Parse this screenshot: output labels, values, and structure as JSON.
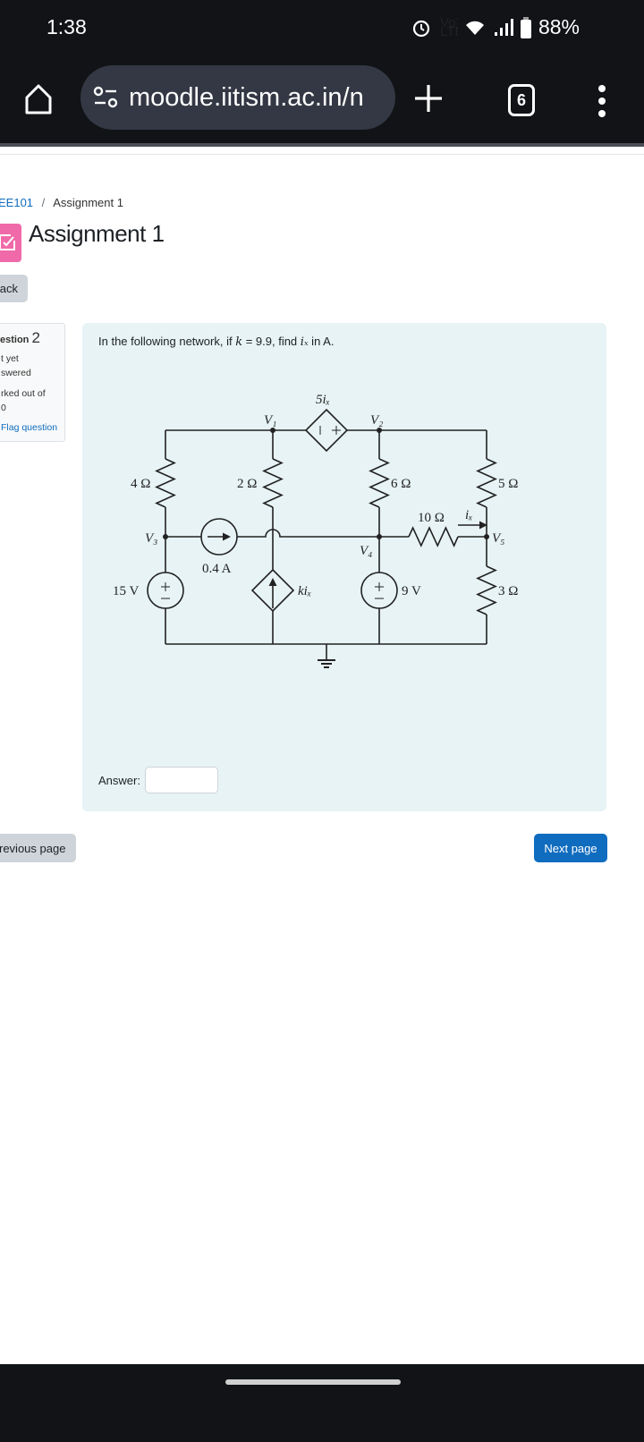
{
  "status_bar": {
    "time": "1:38",
    "battery": "88%",
    "icons": [
      "alarm-icon",
      "volte-icon",
      "wifi-icon",
      "signal-icon",
      "battery-icon"
    ]
  },
  "browser": {
    "url": "moodle.iitism.ac.in/n",
    "tab_count": "6",
    "icons": [
      "home-icon",
      "site-settings-icon",
      "new-tab-plus-icon",
      "tabs-icon",
      "more-menu-icon"
    ]
  },
  "breadcrumb": {
    "course": "EE101",
    "separator": "/",
    "current": "Assignment 1"
  },
  "page": {
    "title": "Assignment 1",
    "back_label": "ack",
    "accent": "#f06aa9"
  },
  "question_info": {
    "label": "estion",
    "number": "2",
    "status_line1": "t yet",
    "status_line2": "swered",
    "marks_line1": "rked out of",
    "marks_line2": "0",
    "flag_label": "Flag question"
  },
  "question": {
    "text_pre": "In the following network, if ",
    "k_symbol": "k",
    "text_mid": " = 9.9, find ",
    "ix_symbol": "iₓ",
    "text_post": " in A.",
    "answer_label": "Answer:",
    "answer_value": ""
  },
  "circuit": {
    "labels": {
      "V1": "V₁",
      "V2": "V₂",
      "V3": "V₃",
      "V4": "V₄",
      "V5": "V₅",
      "dep_vsrc": "5iₓ",
      "dep_isrc": "kiₓ",
      "ix": "iₓ"
    },
    "components": {
      "R4": "4 Ω",
      "R2": "2 Ω",
      "R6": "6 Ω",
      "R5": "5 Ω",
      "R10": "10 Ω",
      "R3": "3 Ω",
      "I1": "0.4 A",
      "Vs1": "15 V",
      "Vs2": "9 V"
    }
  },
  "nav": {
    "previous_label": "revious page",
    "next_label": "Next page",
    "next_color": "#0f6cbf"
  }
}
